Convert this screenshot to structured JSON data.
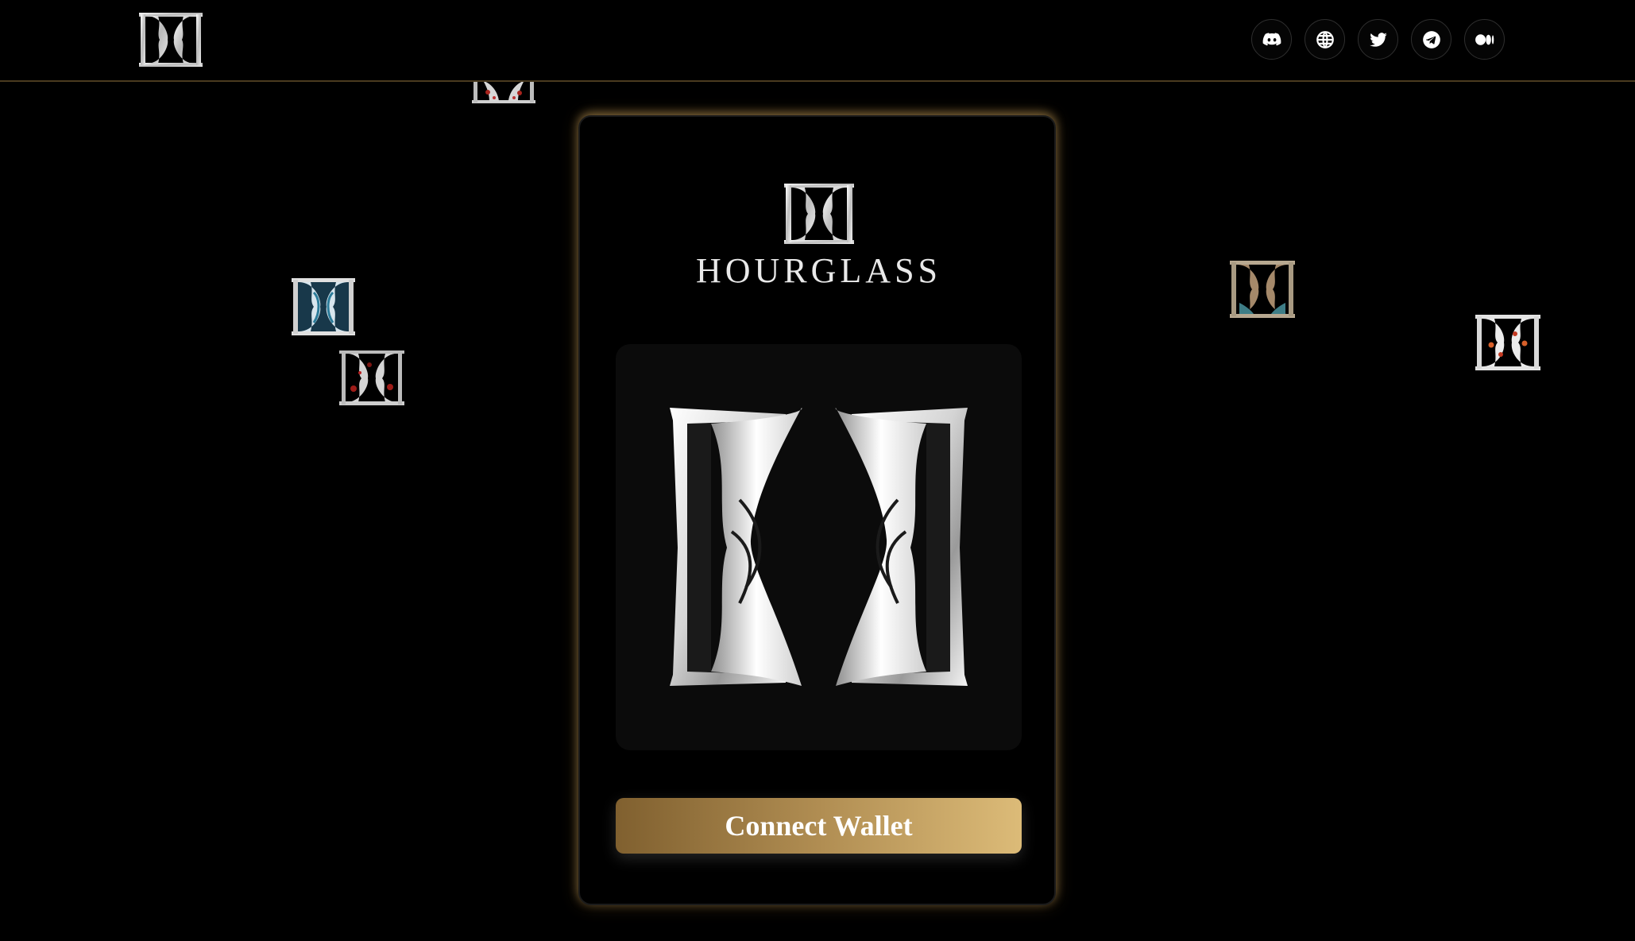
{
  "header": {
    "logo_icon": "hourglass-logo-icon",
    "social_links": [
      {
        "icon": "discord-icon",
        "label": "Discord"
      },
      {
        "icon": "globe-icon",
        "label": "Website"
      },
      {
        "icon": "twitter-icon",
        "label": "Twitter"
      },
      {
        "icon": "telegram-icon",
        "label": "Telegram"
      },
      {
        "icon": "medium-icon",
        "label": "Medium"
      }
    ]
  },
  "card": {
    "brand_name": "HOURGLASS",
    "connect_button_label": "Connect Wallet"
  },
  "colors": {
    "background": "#000000",
    "accent_gold_start": "#80602f",
    "accent_gold_end": "#dcbb78",
    "header_border": "#4a3b1f"
  }
}
